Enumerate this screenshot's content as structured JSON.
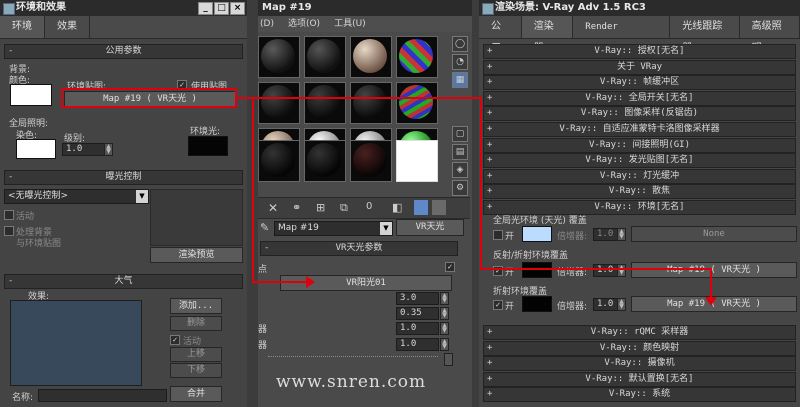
{
  "left_window": {
    "title": "环境和效果",
    "tabs": [
      "环境",
      "效果"
    ],
    "common": {
      "header": "公用参数",
      "background": "背景:",
      "color": "颜色:",
      "env_map": "环境贴图:",
      "use_map": "使用贴图",
      "map_button": "Map #19  ( VR天光 )",
      "global_lighting": "全局照明:",
      "tint": "染色:",
      "level": "级别:",
      "level_value": "1.0",
      "ambient": "环境光:"
    },
    "exposure": {
      "header": "曝光控制",
      "dropdown": "<无曝光控制>",
      "active": "活动",
      "process_bg": "处理背景",
      "and_env": "与环境贴图",
      "render_preview": "渲染预览"
    },
    "atmosphere": {
      "header": "大气",
      "effects": "效果:",
      "add": "添加...",
      "delete": "删除",
      "active": "活动",
      "move_up": "上移",
      "move_down": "下移",
      "name": "名称:",
      "merge": "合并"
    }
  },
  "middle_window": {
    "title": "Map #19",
    "menu": [
      "(D)",
      "选项(O)",
      "工具(U)"
    ],
    "map_dropdown": "Map #19",
    "map_type_button": "VR天光",
    "params_header": "VR天光参数",
    "sun_label": "VR阳光01",
    "values": [
      "3.0",
      "0.35",
      "1.0",
      "1.0"
    ],
    "cut_labels": [
      "点",
      "器",
      "器"
    ],
    "watermark": "www.snren.com"
  },
  "right_window": {
    "title": "渲染场景: V-Ray Adv 1.5 RC3",
    "tabs": [
      "公用",
      "渲染器",
      "Render Elements",
      "光线跟踪器",
      "高级照明"
    ],
    "rollouts_top": [
      "V-Ray:: 授权[无名]",
      "关于 VRay",
      "V-Ray:: 帧缓冲区",
      "V-Ray:: 全局开关[无名]",
      "V-Ray:: 图像采样(反锯齿)",
      "V-Ray:: 自适应准蒙特卡洛图像采样器",
      "V-Ray:: 间接照明(GI)",
      "V-Ray:: 发光贴图[无名]",
      "V-Ray:: 灯光缓冲",
      "V-Ray:: 散焦",
      "V-Ray:: 环境[无名]"
    ],
    "env": {
      "gi_group": "全局光环境 (天光) 覆盖",
      "on": "开",
      "multiplier": "倍增器:",
      "gi_value": "1.0",
      "gi_map": "None",
      "refl_group": "反射/折射环境覆盖",
      "refl_value": "1.0",
      "refl_map": "Map #19   ( VR天光 )",
      "refr_group": "折射环境覆盖",
      "refr_value": "1.0",
      "refr_map": "Map #19   ( VR天光 )"
    },
    "rollouts_bottom": [
      "V-Ray:: rQMC 采样器",
      "V-Ray:: 颜色映射",
      "V-Ray:: 摄像机",
      "V-Ray:: 默认置换[无名]",
      "V-Ray:: 系统"
    ]
  },
  "colors": {
    "annotation": "#e0000c",
    "panel": "#444444"
  }
}
